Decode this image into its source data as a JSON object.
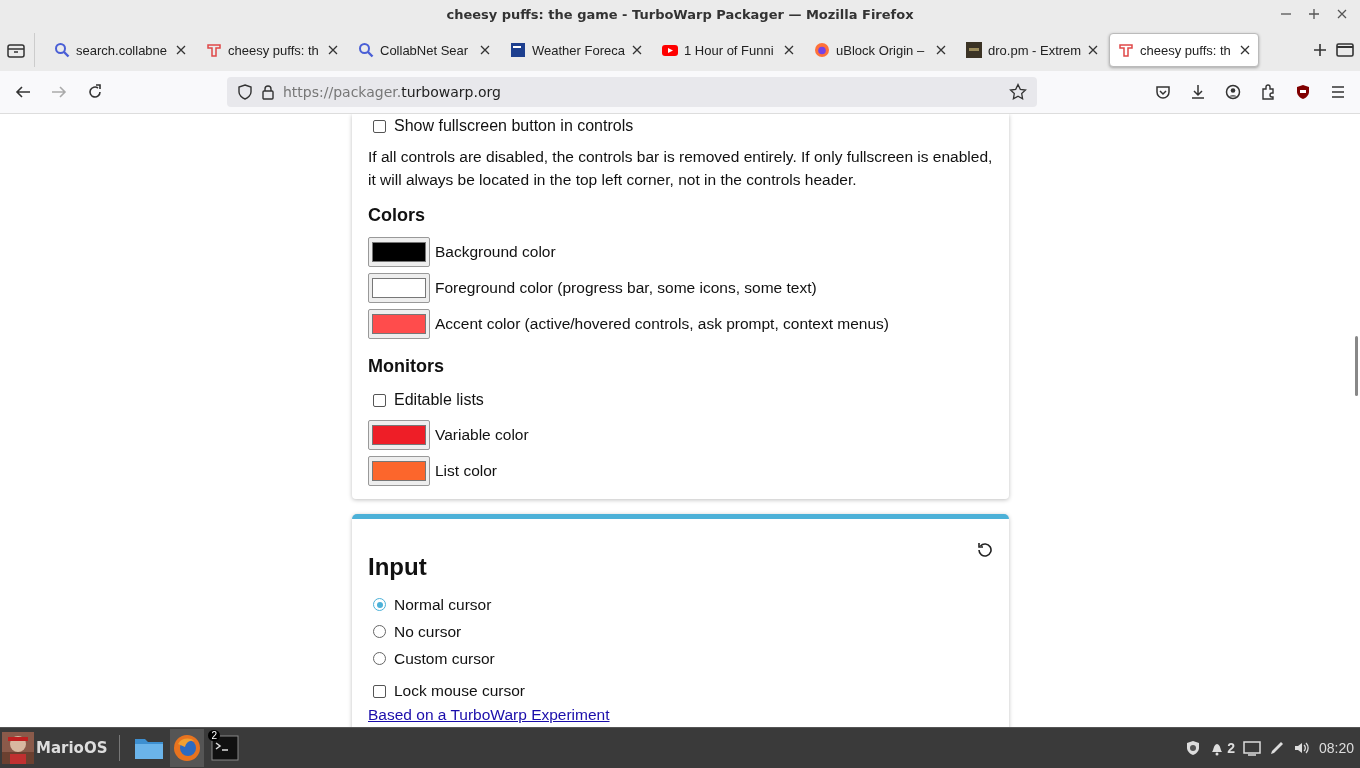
{
  "window": {
    "title": "cheesy puffs: the game - TurboWarp Packager — Mozilla Firefox"
  },
  "tabs": [
    {
      "kind": "search",
      "label": "search.collabne",
      "selected": false
    },
    {
      "kind": "turbowarp",
      "label": "cheesy puffs: th",
      "selected": false
    },
    {
      "kind": "search",
      "label": "CollabNet Sear",
      "selected": false
    },
    {
      "kind": "weather",
      "label": "Weather Foreca",
      "selected": false
    },
    {
      "kind": "video",
      "label": "1 Hour of Funni",
      "selected": false
    },
    {
      "kind": "firefox",
      "label": "uBlock Origin –",
      "selected": false
    },
    {
      "kind": "dark",
      "label": "dro.pm - Extrem",
      "selected": false
    },
    {
      "kind": "turbowarp",
      "label": "cheesy puffs: th",
      "selected": true
    }
  ],
  "address_bar": {
    "url_prefix": "https://packager.",
    "url_domain": "turbowarp.org"
  },
  "controls_section": {
    "checkboxes": [
      {
        "label": "Show fullscreen button in controls",
        "checked": false
      }
    ],
    "note": "If all controls are disabled, the controls bar is removed entirely. If only fullscreen is enabled, it will always be located in the top left corner, not in the controls header.",
    "colors_heading": "Colors",
    "colors": [
      {
        "label": "Background color",
        "color": "#000000"
      },
      {
        "label": "Foreground color (progress bar, some icons, some text)",
        "color": "#ffffff"
      },
      {
        "label": "Accent color (active/hovered controls, ask prompt, context menus)",
        "color": "#ff4c4c"
      }
    ],
    "monitors_heading": "Monitors",
    "monitor_options": [
      {
        "kind": "checkbox",
        "label": "Editable lists",
        "checked": false
      },
      {
        "kind": "color",
        "label": "Variable color",
        "color": "#ee1e27"
      },
      {
        "kind": "color",
        "label": "List color",
        "color": "#fc662c"
      }
    ]
  },
  "input_section": {
    "title": "Input",
    "cursor_options": [
      {
        "label": "Normal cursor",
        "selected": true
      },
      {
        "label": "No cursor",
        "selected": false
      },
      {
        "label": "Custom cursor",
        "selected": false
      }
    ],
    "checkboxes": [
      {
        "label": "Lock mouse cursor",
        "checked": false
      }
    ],
    "footer_link": "Based on a TurboWarp Experiment"
  },
  "taskbar": {
    "start_label": "MarioOS",
    "apps": [
      {
        "kind": "folder"
      },
      {
        "kind": "firefox",
        "selected": true
      },
      {
        "kind": "terminal",
        "selected": false,
        "badge": "2"
      }
    ],
    "notification_count": "2",
    "clock": "08:20"
  }
}
